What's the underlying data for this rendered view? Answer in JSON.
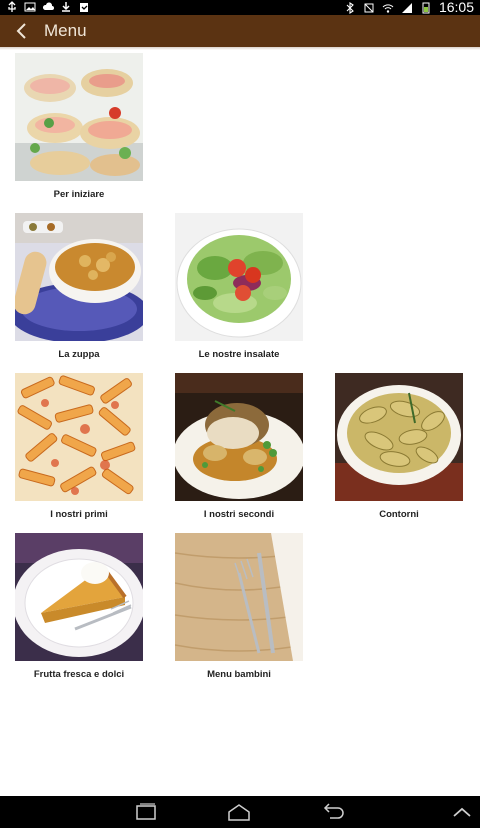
{
  "status_bar": {
    "time": "16:05",
    "left_icons": [
      "usb-icon",
      "image-icon",
      "cloud-icon",
      "download-icon",
      "clipboard-check-icon"
    ],
    "right_icons": [
      "bluetooth-icon",
      "mute-icon",
      "wifi-icon",
      "signal-icon",
      "battery-icon"
    ]
  },
  "app_bar": {
    "back_icon": "chevron-left-icon",
    "title": "Menu",
    "background": "#5b3312"
  },
  "categories": [
    {
      "label": "Per iniziare",
      "image": "canapes-photo"
    },
    {
      "label": "La zuppa",
      "image": "soup-photo"
    },
    {
      "label": "Le nostre insalate",
      "image": "salad-photo"
    },
    {
      "label": "I nostri primi",
      "image": "pasta-photo"
    },
    {
      "label": "I nostri secondi",
      "image": "main-course-photo"
    },
    {
      "label": "Contorni",
      "image": "potatoes-photo"
    },
    {
      "label": "Frutta fresca e dolci",
      "image": "pie-photo"
    },
    {
      "label": "Menu bambini",
      "image": "cutlery-photo"
    }
  ],
  "nav_bar": {
    "icons": [
      "recent-apps-icon",
      "home-icon",
      "back-icon",
      "hide-keyboard-icon"
    ]
  }
}
